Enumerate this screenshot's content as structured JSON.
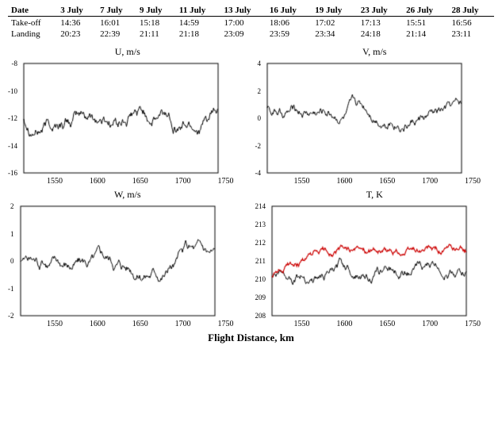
{
  "table": {
    "headers": [
      "Date",
      "3 July",
      "7 July",
      "9 July",
      "11 July",
      "13 July",
      "16 July",
      "19 July",
      "23 July",
      "26 July",
      "28 July"
    ],
    "rows": [
      {
        "label": "Take-off",
        "values": [
          "14:36",
          "16:01",
          "15:18",
          "14:59",
          "17:00",
          "18:06",
          "17:02",
          "17:13",
          "15:51",
          "16:56"
        ]
      },
      {
        "label": "Landing",
        "values": [
          "20:23",
          "22:39",
          "21:11",
          "21:18",
          "23:09",
          "23:59",
          "23:34",
          "24:18",
          "21:14",
          "23:11"
        ]
      }
    ]
  },
  "charts": {
    "xLabels": [
      "1550",
      "1600",
      "1650",
      "1700",
      "1750"
    ],
    "u": {
      "title": "U, m/s",
      "yLabels": [
        "-8",
        "-10",
        "-12",
        "-14",
        "-16"
      ],
      "color": "#000"
    },
    "v": {
      "title": "V, m/s",
      "yLabels": [
        "4",
        "2",
        "0",
        "-2",
        "-4"
      ],
      "color": "#000"
    },
    "w": {
      "title": "W, m/s",
      "yLabels": [
        "2",
        "1",
        "0",
        "-1",
        "-2"
      ],
      "color": "#000"
    },
    "t": {
      "title": "T, K",
      "yLabels": [
        "214",
        "213",
        "212",
        "211",
        "210",
        "209",
        "208"
      ],
      "color": "#c00"
    }
  },
  "footer": {
    "label": "Flight Distance, km"
  }
}
